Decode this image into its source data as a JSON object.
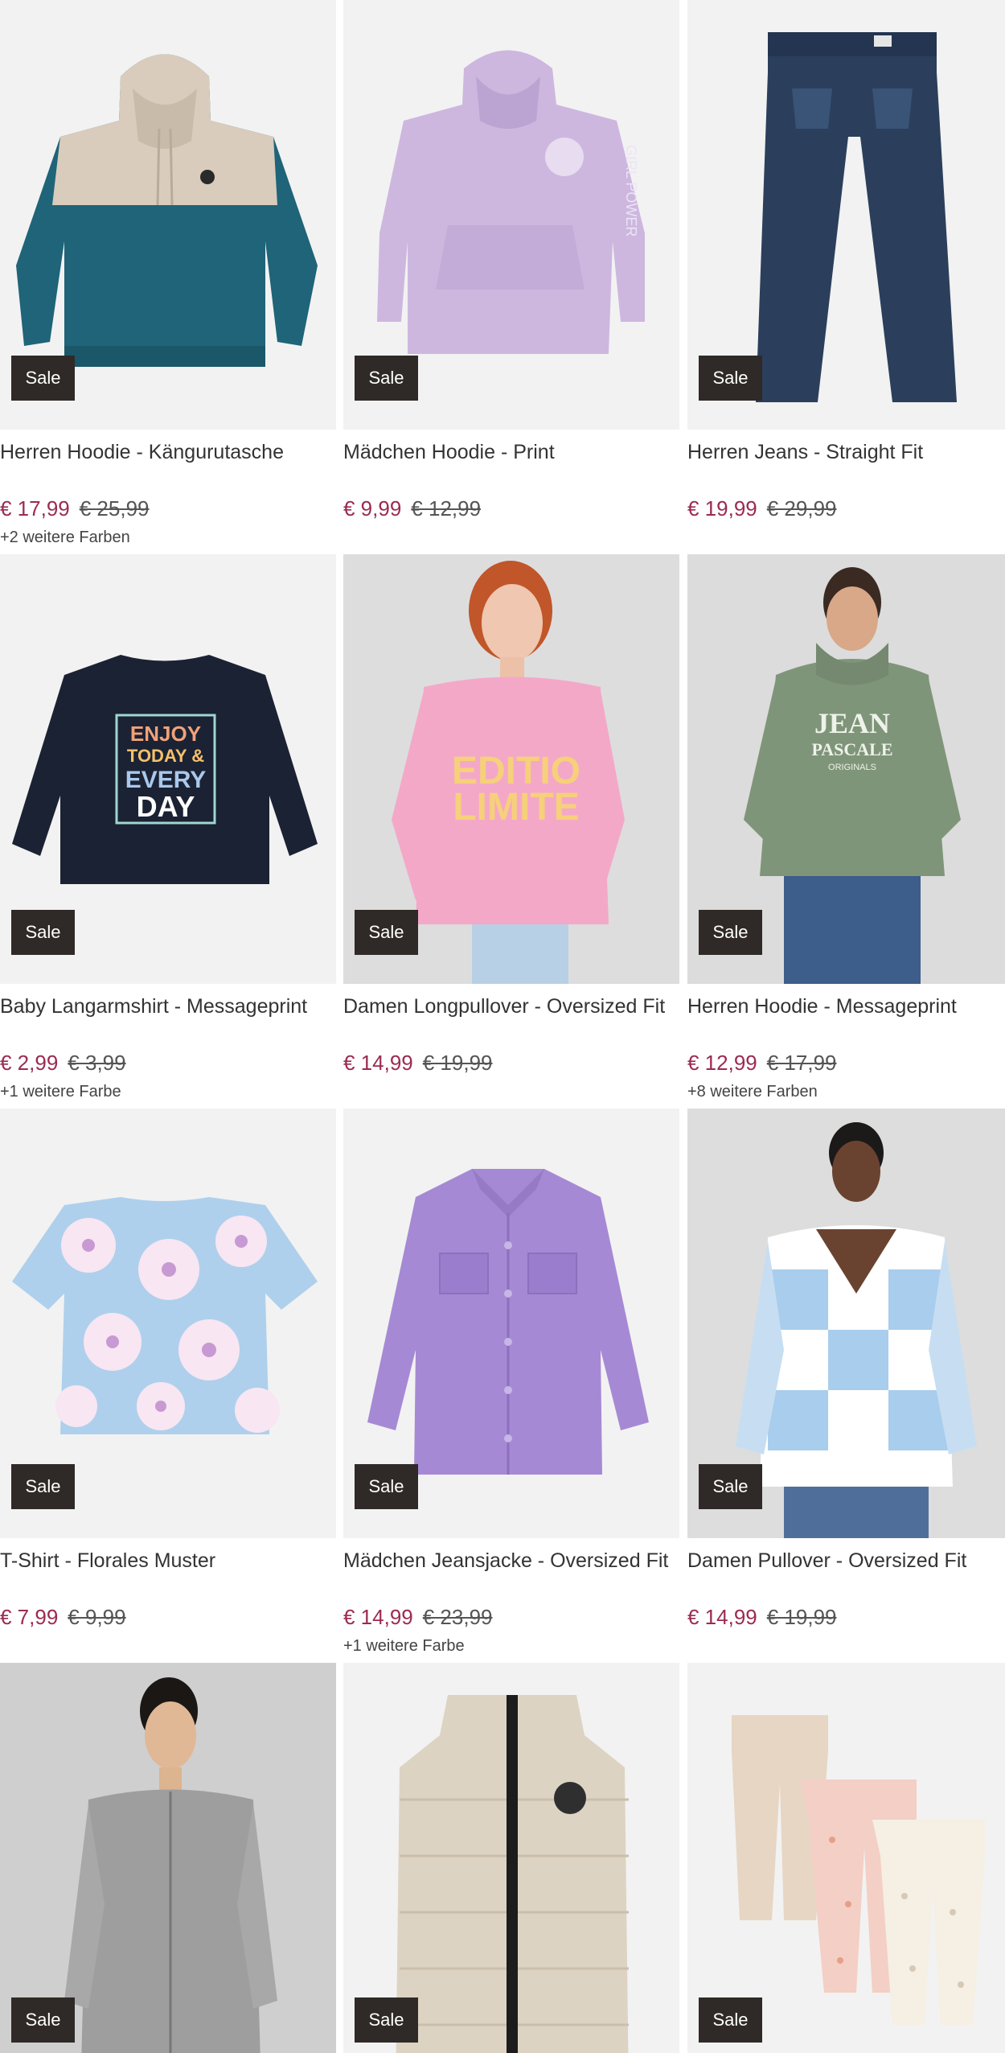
{
  "products": [
    {
      "title": "Herren Hoodie - Kängurutasche",
      "badge": "Sale",
      "price": "€ 17,99",
      "old_price": "€ 25,99",
      "colors": "+2 weitere Farben",
      "image_icon": "hoodie-image"
    },
    {
      "title": "Mädchen Hoodie - Print",
      "badge": "Sale",
      "price": "€ 9,99",
      "old_price": "€ 12,99",
      "colors": "",
      "image_icon": "hoodie-image"
    },
    {
      "title": "Herren Jeans - Straight Fit",
      "badge": "Sale",
      "price": "€ 19,99",
      "old_price": "€ 29,99",
      "colors": "",
      "image_icon": "jeans-image"
    },
    {
      "title": "Baby Langarmshirt - Messageprint",
      "badge": "Sale",
      "price": "€ 2,99",
      "old_price": "€ 3,99",
      "colors": "+1 weitere Farbe",
      "image_icon": "shirt-image",
      "print": [
        "ENJOY",
        "TODAY &",
        "EVERY",
        "DAY"
      ]
    },
    {
      "title": "Damen Longpullover - Oversized Fit",
      "badge": "Sale",
      "price": "€ 14,99",
      "old_price": "€ 19,99",
      "colors": "",
      "image_icon": "model-image",
      "print": [
        "EDITIO",
        "LIMITE"
      ]
    },
    {
      "title": "Herren Hoodie - Messageprint",
      "badge": "Sale",
      "price": "€ 12,99",
      "old_price": "€ 17,99",
      "colors": "+8 weitere Farben",
      "image_icon": "model-image",
      "print": [
        "JEAN",
        "PASCALE",
        "ORIGINALS"
      ]
    },
    {
      "title": "T-Shirt - Florales Muster",
      "badge": "Sale",
      "price": "€ 7,99",
      "old_price": "€ 9,99",
      "colors": "",
      "image_icon": "tshirt-image"
    },
    {
      "title": "Mädchen Jeansjacke - Oversized Fit",
      "badge": "Sale",
      "price": "€ 14,99",
      "old_price": "€ 23,99",
      "colors": "+1 weitere Farbe",
      "image_icon": "jacket-image"
    },
    {
      "title": "Damen Pullover - Oversized Fit",
      "badge": "Sale",
      "price": "€ 14,99",
      "old_price": "€ 19,99",
      "colors": "",
      "image_icon": "model-image"
    },
    {
      "title": "",
      "badge": "Sale",
      "price": "",
      "old_price": "",
      "colors": "",
      "image_icon": "model-image"
    },
    {
      "title": "",
      "badge": "Sale",
      "price": "",
      "old_price": "",
      "colors": "",
      "image_icon": "vest-image"
    },
    {
      "title": "",
      "badge": "Sale",
      "price": "",
      "old_price": "",
      "colors": "",
      "image_icon": "leggings-image"
    }
  ],
  "colors": {
    "sale_price": "#9b2b52",
    "badge_bg": "#2f2a27",
    "image_bg": "#f2f2f2"
  }
}
